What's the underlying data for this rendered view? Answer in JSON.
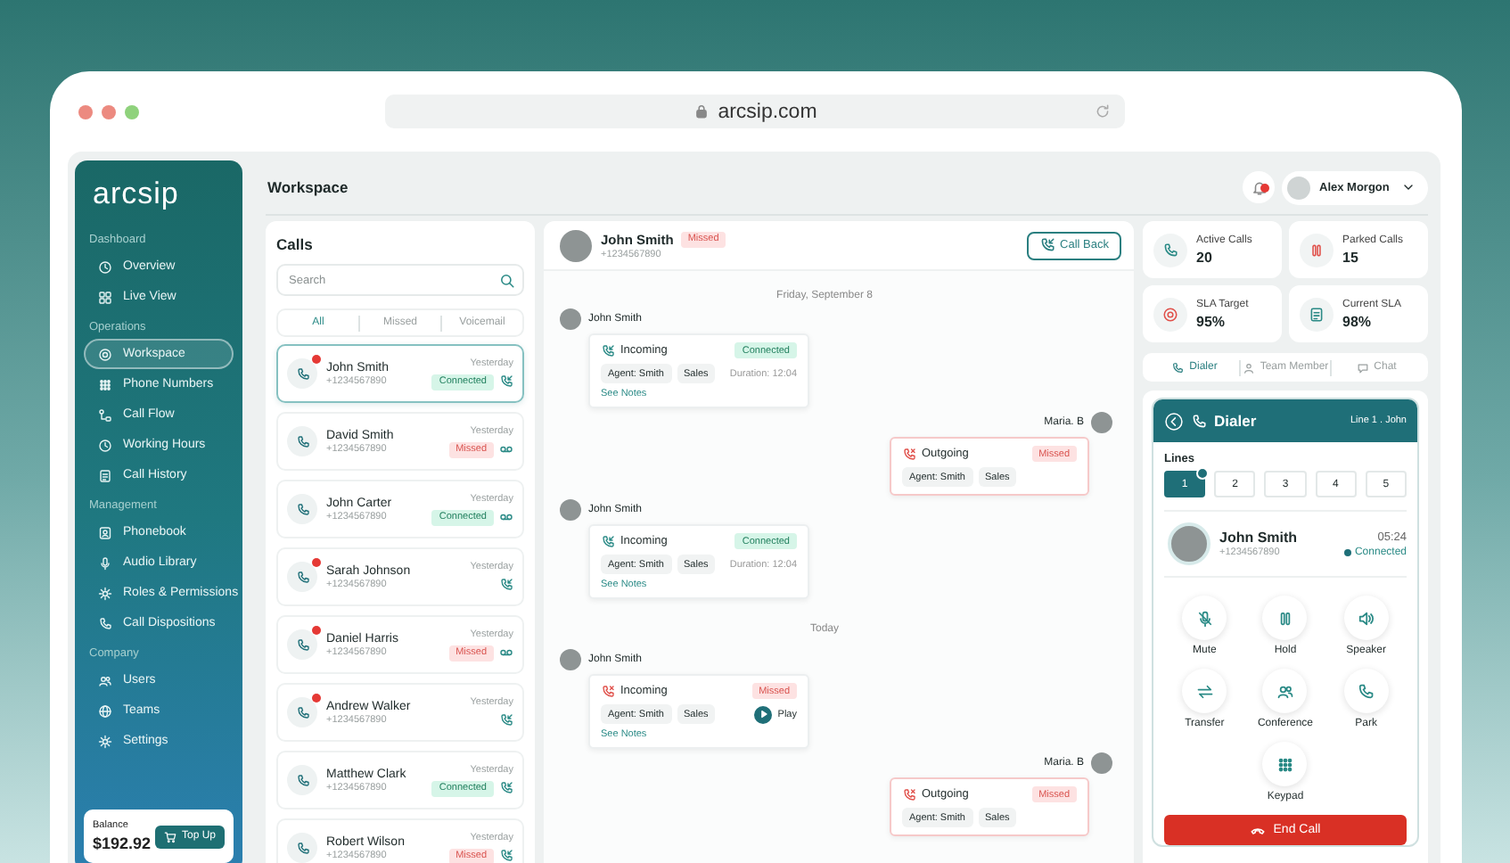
{
  "browser": {
    "url": "arcsip.com"
  },
  "sidebar": {
    "logo": "arcsip",
    "sections": [
      {
        "title": "Dashboard",
        "items": [
          {
            "label": "Overview",
            "selected": false
          },
          {
            "label": "Live View",
            "selected": false
          }
        ]
      },
      {
        "title": "Operations",
        "items": [
          {
            "label": "Workspace",
            "selected": true
          },
          {
            "label": "Phone Numbers",
            "selected": false
          },
          {
            "label": "Call Flow",
            "selected": false
          },
          {
            "label": "Working Hours",
            "selected": false
          },
          {
            "label": "Call History",
            "selected": false
          }
        ]
      },
      {
        "title": "Management",
        "items": [
          {
            "label": "Phonebook",
            "selected": false
          },
          {
            "label": "Audio Library",
            "selected": false
          },
          {
            "label": "Roles & Permissions",
            "selected": false
          },
          {
            "label": "Call Dispositions",
            "selected": false
          }
        ]
      },
      {
        "title": "Company",
        "items": [
          {
            "label": "Users",
            "selected": false
          },
          {
            "label": "Teams",
            "selected": false
          },
          {
            "label": "Settings",
            "selected": false
          }
        ]
      }
    ],
    "balance": {
      "label": "Balance",
      "amount": "$192.92",
      "button": "Top Up"
    }
  },
  "header": {
    "title": "Workspace",
    "notifications": true,
    "user": "Alex Morgon"
  },
  "calls": {
    "title": "Calls",
    "search": {
      "placeholder": "Search"
    },
    "filters": [
      {
        "label": "All",
        "selected": true
      },
      {
        "label": "Missed",
        "selected": false
      },
      {
        "label": "Voicemail",
        "selected": false
      }
    ],
    "items": [
      {
        "name": "John Smith",
        "phone": "+1234567890",
        "time": "Yesterday",
        "status": {
          "label": "Connected",
          "kind": "connected"
        },
        "kind": "incoming",
        "unread": true,
        "selected": true
      },
      {
        "name": "David Smith",
        "phone": "+1234567890",
        "time": "Yesterday",
        "status": {
          "label": "Missed",
          "kind": "missed"
        },
        "kind": "voicemail",
        "unread": false,
        "selected": false
      },
      {
        "name": "John Carter",
        "phone": "+1234567890",
        "time": "Yesterday",
        "status": {
          "label": "Connected",
          "kind": "connected"
        },
        "kind": "voicemail",
        "unread": false,
        "selected": false
      },
      {
        "name": "Sarah Johnson",
        "phone": "+1234567890",
        "time": "Yesterday",
        "kind": "incoming",
        "unread": true,
        "selected": false
      },
      {
        "name": "Daniel Harris",
        "phone": "+1234567890",
        "time": "Yesterday",
        "status": {
          "label": "Missed",
          "kind": "missed"
        },
        "kind": "voicemail",
        "unread": true,
        "selected": false
      },
      {
        "name": "Andrew Walker",
        "phone": "+1234567890",
        "time": "Yesterday",
        "kind": "incoming",
        "unread": true,
        "selected": false
      },
      {
        "name": "Matthew Clark",
        "phone": "+1234567890",
        "time": "Yesterday",
        "status": {
          "label": "Connected",
          "kind": "connected"
        },
        "kind": "incoming",
        "unread": false,
        "selected": false
      },
      {
        "name": "Robert Wilson",
        "phone": "+1234567890",
        "time": "Yesterday",
        "status": {
          "label": "Missed",
          "kind": "missed"
        },
        "kind": "incoming",
        "unread": false,
        "selected": false
      }
    ]
  },
  "conversation": {
    "name": "John Smith",
    "phone": "+1234567890",
    "status": {
      "label": "Missed",
      "kind": "missed"
    },
    "button": "Call Back",
    "timeline": [
      {
        "kind": "date",
        "label": "Friday, September 8"
      },
      {
        "kind": "incoming",
        "sender": "John Smith",
        "direction": "Incoming",
        "status": {
          "label": "Connected",
          "kind": "connected"
        },
        "tags": [
          "Agent: Smith",
          "Sales"
        ],
        "duration": "Duration: 12:04",
        "link": "See Notes"
      },
      {
        "kind": "outgoing",
        "sender": "Maria. B",
        "direction": "Outgoing",
        "status": {
          "label": "Missed",
          "kind": "missed"
        },
        "tags": [
          "Agent: Smith",
          "Sales"
        ]
      },
      {
        "kind": "incoming",
        "sender": "John Smith",
        "direction": "Incoming",
        "status": {
          "label": "Connected",
          "kind": "connected"
        },
        "tags": [
          "Agent: Smith",
          "Sales"
        ],
        "duration": "Duration: 12:04",
        "link": "See Notes"
      },
      {
        "kind": "date",
        "label": "Today"
      },
      {
        "kind": "incoming",
        "sender": "John Smith",
        "direction": "Incoming",
        "status": {
          "label": "Missed",
          "kind": "missed"
        },
        "tags": [
          "Agent: Smith",
          "Sales"
        ],
        "play": "Play",
        "link": "See Notes"
      },
      {
        "kind": "outgoing",
        "sender": "Maria. B",
        "direction": "Outgoing",
        "status": {
          "label": "Missed",
          "kind": "missed"
        },
        "tags": [
          "Agent: Smith",
          "Sales"
        ]
      }
    ]
  },
  "stats": [
    {
      "label": "Active Calls",
      "value": "20",
      "color": "#2a8a86"
    },
    {
      "label": "Parked Calls",
      "value": "15",
      "color": "#e0504a"
    },
    {
      "label": "SLA Target",
      "value": "95%",
      "color": "#e0504a"
    },
    {
      "label": "Current SLA",
      "value": "98%",
      "color": "#2a8a86"
    }
  ],
  "panel_tabs": [
    {
      "label": "Dialer",
      "selected": true
    },
    {
      "label": "Team Member",
      "selected": false
    },
    {
      "label": "Chat",
      "selected": false
    }
  ],
  "dialer": {
    "title": "Dialer",
    "line_info": "Line 1 . John",
    "lines_label": "Lines",
    "lines": [
      {
        "label": "1",
        "selected": true,
        "active": true
      },
      {
        "label": "2",
        "selected": false,
        "active": false
      },
      {
        "label": "3",
        "selected": false,
        "active": false
      },
      {
        "label": "4",
        "selected": false,
        "active": false
      },
      {
        "label": "5",
        "selected": false,
        "active": false
      }
    ],
    "contact": {
      "name": "John Smith",
      "phone": "+1234567890",
      "timer": "05:24",
      "status": "Connected"
    },
    "actions": [
      {
        "label": "Mute"
      },
      {
        "label": "Hold"
      },
      {
        "label": "Speaker"
      },
      {
        "label": "Transfer"
      },
      {
        "label": "Conference"
      },
      {
        "label": "Park"
      },
      {
        "label": "Keypad"
      }
    ],
    "end_button": "End Call"
  }
}
